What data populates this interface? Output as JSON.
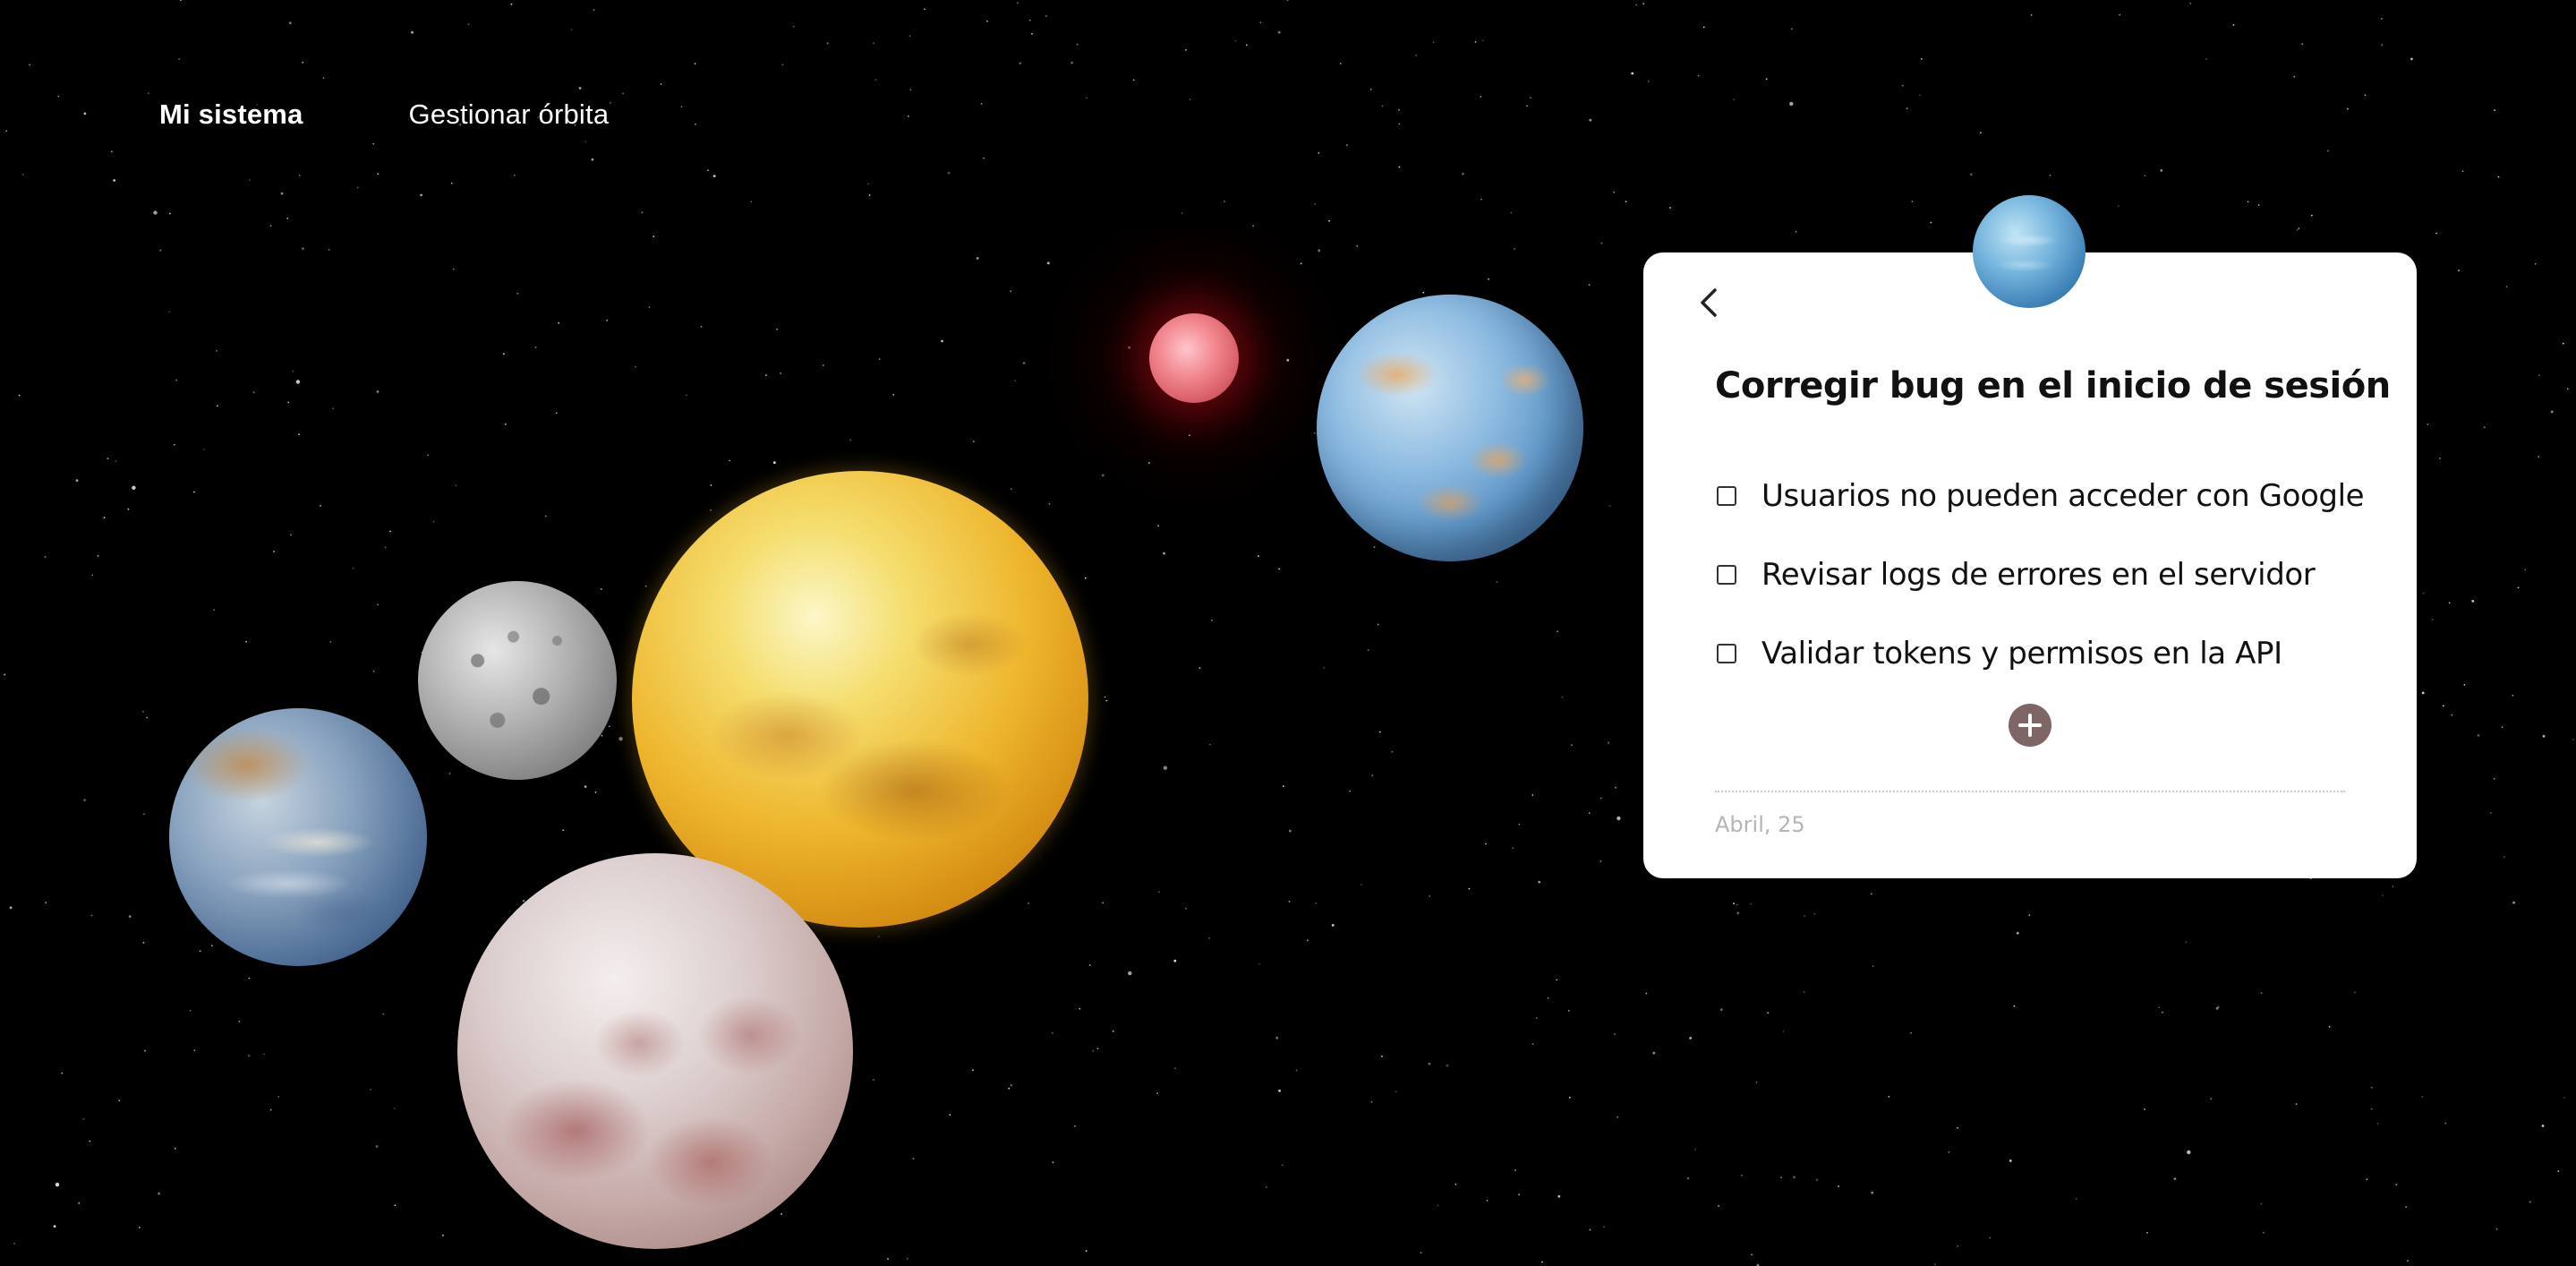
{
  "nav": {
    "items": [
      {
        "label": "Mi sistema",
        "active": true
      },
      {
        "label": "Gestionar órbita",
        "active": false
      }
    ]
  },
  "task_card": {
    "title": "Corregir bug en el inicio de sesión",
    "checklist": [
      {
        "label": "Usuarios no pueden acceder con Google",
        "checked": false
      },
      {
        "label": "Revisar logs de errores en el servidor",
        "checked": false
      },
      {
        "label": "Validar tokens y permisos en la API",
        "checked": false
      }
    ],
    "date": "Abril, 25",
    "icons": {
      "back": "chevron-left-icon",
      "add": "plus-circle-icon"
    }
  },
  "colors": {
    "background": "#000000",
    "card_background": "#ffffff",
    "add_button": "#7e6667",
    "date_text": "#b5b5b5"
  }
}
